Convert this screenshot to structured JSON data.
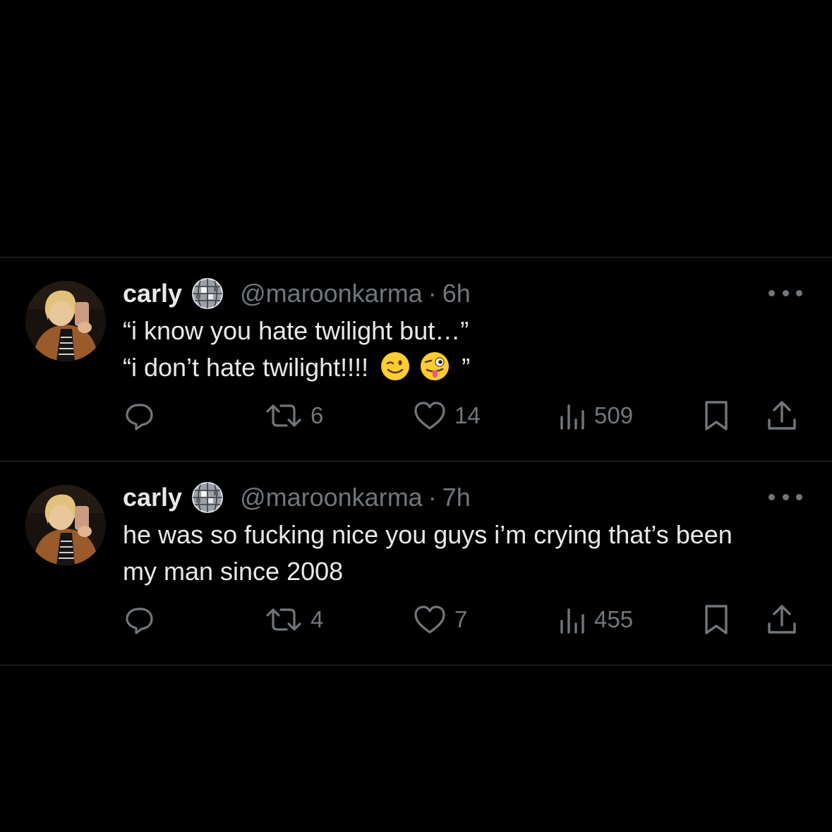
{
  "tweets": [
    {
      "display_name": "carly",
      "handle": "@maroonkarma",
      "separator": "·",
      "time": "6h",
      "text_line_1": "“i know you hate twilight but…”",
      "text_line_2": "“i don’t hate twilight!!!!",
      "text_line_2_end": "”",
      "emojis": [
        "winking-face-emoji",
        "zany-face-emoji"
      ],
      "retweets": "6",
      "likes": "14",
      "views": "509"
    },
    {
      "display_name": "carly",
      "handle": "@maroonkarma",
      "separator": "·",
      "time": "7h",
      "text_line_1": "he was so fucking nice you guys i’m crying that’s been",
      "text_line_2": "my man since 2008",
      "retweets": "4",
      "likes": "7",
      "views": "455"
    }
  ],
  "colors": {
    "background": "#000000",
    "primary_text": "#e7e9ea",
    "secondary_text": "#71767b",
    "divider": "#2f3336"
  },
  "icons": [
    "reply-icon",
    "retweet-icon",
    "like-icon",
    "views-icon",
    "bookmark-icon",
    "share-icon",
    "more-icon",
    "disco-ball-badge"
  ]
}
